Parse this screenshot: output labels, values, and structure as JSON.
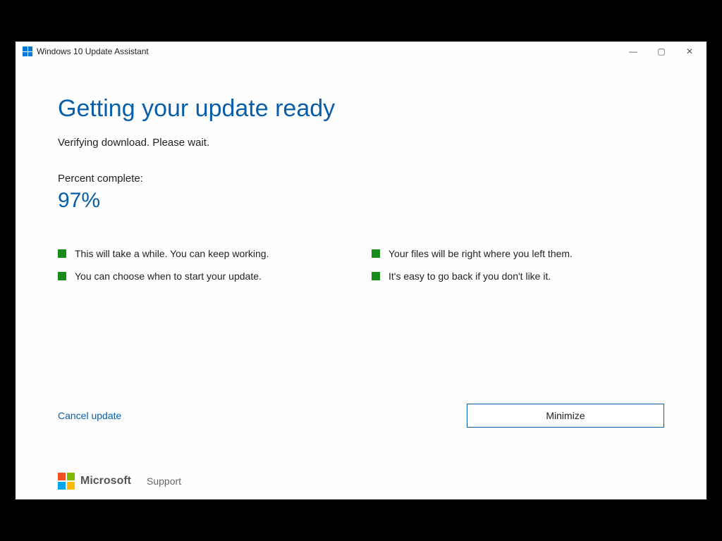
{
  "titlebar": {
    "title": "Windows 10 Update Assistant"
  },
  "main": {
    "heading": "Getting your update ready",
    "status": "Verifying download. Please wait.",
    "percent_label": "Percent complete:",
    "percent_value": "97%",
    "bullets": {
      "b1": "This will take a while. You can keep working.",
      "b2": "Your files will be right where you left them.",
      "b3": "You can choose when to start your update.",
      "b4": "It's easy to go back if you don't like it."
    }
  },
  "actions": {
    "cancel": "Cancel update",
    "minimize": "Minimize"
  },
  "footer": {
    "brand": "Microsoft",
    "support": "Support"
  }
}
